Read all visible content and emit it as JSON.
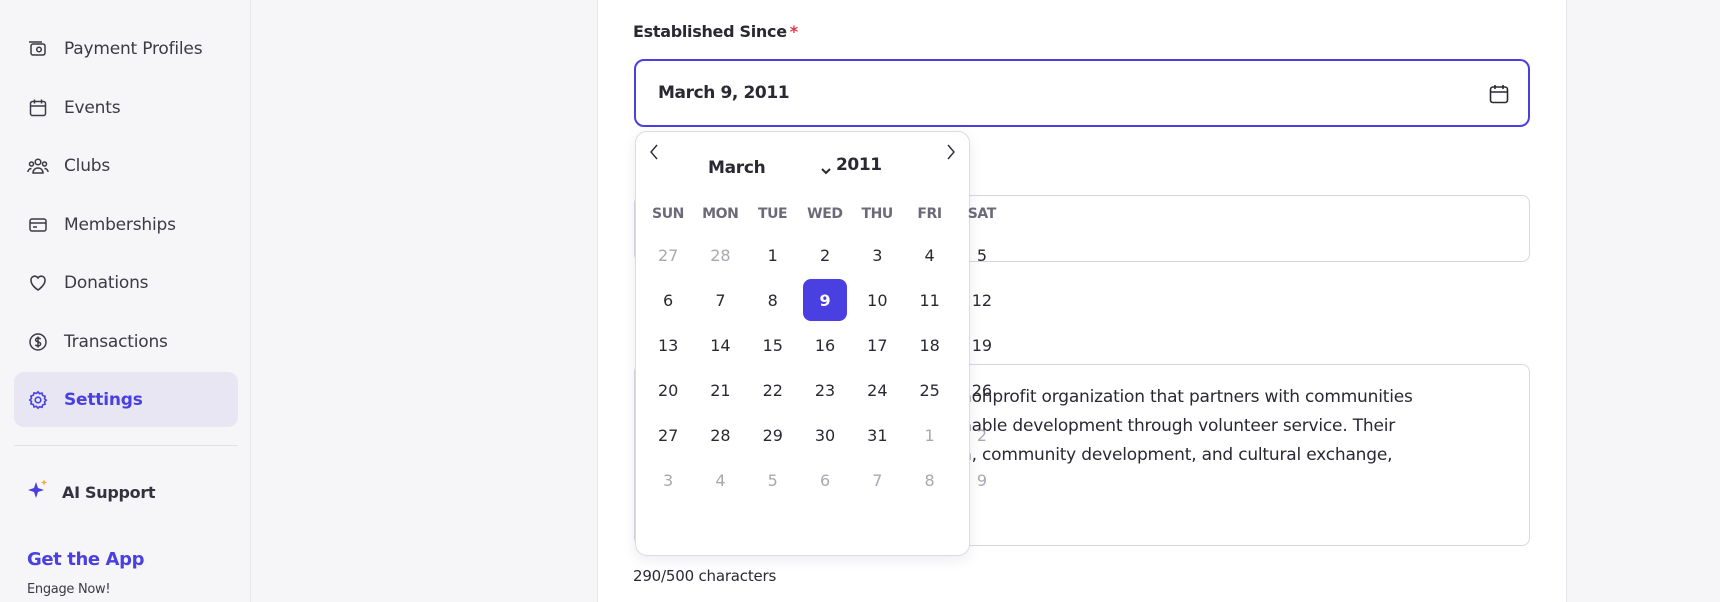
{
  "sidebar": {
    "items": [
      {
        "label": "Payment Profiles",
        "icon": "camera-card-icon"
      },
      {
        "label": "Events",
        "icon": "calendar-icon"
      },
      {
        "label": "Clubs",
        "icon": "people-icon"
      },
      {
        "label": "Memberships",
        "icon": "card-icon"
      },
      {
        "label": "Donations",
        "icon": "heart-icon"
      },
      {
        "label": "Transactions",
        "icon": "dollar-circle-icon"
      },
      {
        "label": "Settings",
        "icon": "gear-icon",
        "active": true
      }
    ],
    "ai_support": "AI Support",
    "get_app": "Get the App",
    "engage": "Engage Now!"
  },
  "form": {
    "established_label": "Established Since",
    "required_mark": "*",
    "established_value": "March 9, 2011",
    "description_lines": [
      "nonprofit organization that partners with communities",
      "nable development through volunteer service. Their",
      "n, community development, and cultural exchange,"
    ],
    "char_count": "290/500 characters"
  },
  "datepicker": {
    "month": "March",
    "year": "2011",
    "weekdays": [
      "SUN",
      "MON",
      "TUE",
      "WED",
      "THU",
      "FRI",
      "SAT"
    ],
    "weeks": [
      [
        {
          "d": "27",
          "m": true
        },
        {
          "d": "28",
          "m": true
        },
        {
          "d": "1"
        },
        {
          "d": "2"
        },
        {
          "d": "3"
        },
        {
          "d": "4"
        },
        {
          "d": "5"
        }
      ],
      [
        {
          "d": "6"
        },
        {
          "d": "7"
        },
        {
          "d": "8"
        },
        {
          "d": "9",
          "sel": true
        },
        {
          "d": "10"
        },
        {
          "d": "11"
        },
        {
          "d": "12"
        }
      ],
      [
        {
          "d": "13"
        },
        {
          "d": "14"
        },
        {
          "d": "15"
        },
        {
          "d": "16"
        },
        {
          "d": "17"
        },
        {
          "d": "18"
        },
        {
          "d": "19"
        }
      ],
      [
        {
          "d": "20"
        },
        {
          "d": "21"
        },
        {
          "d": "22"
        },
        {
          "d": "23"
        },
        {
          "d": "24"
        },
        {
          "d": "25"
        },
        {
          "d": "26"
        }
      ],
      [
        {
          "d": "27"
        },
        {
          "d": "28"
        },
        {
          "d": "29"
        },
        {
          "d": "30"
        },
        {
          "d": "31"
        },
        {
          "d": "1",
          "m": true
        },
        {
          "d": "2",
          "m": true
        }
      ],
      [
        {
          "d": "3",
          "m": true
        },
        {
          "d": "4",
          "m": true
        },
        {
          "d": "5",
          "m": true
        },
        {
          "d": "6",
          "m": true
        },
        {
          "d": "7",
          "m": true
        },
        {
          "d": "8",
          "m": true
        },
        {
          "d": "9",
          "m": true
        }
      ]
    ],
    "accent": "#4a3fe0"
  }
}
